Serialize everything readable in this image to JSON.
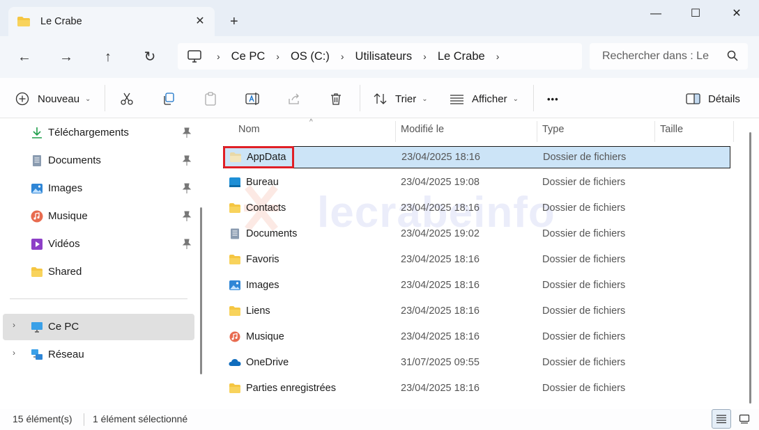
{
  "window": {
    "tab_title": "Le Crabe",
    "tab_close": "✕",
    "new_tab": "+",
    "minimize": "—",
    "maximize": "☐",
    "close": "✕"
  },
  "nav": {
    "back": "←",
    "forward": "→",
    "up": "↑",
    "refresh": "↻"
  },
  "breadcrumb": [
    "Ce PC",
    "OS (C:)",
    "Utilisateurs",
    "Le Crabe"
  ],
  "search": {
    "placeholder": "Rechercher dans : Le"
  },
  "toolbar": {
    "new_label": "Nouveau",
    "sort_label": "Trier",
    "view_label": "Afficher",
    "more_label": "•••",
    "details_label": "Détails",
    "caret": "⌄"
  },
  "sidebar": {
    "quick_access": [
      {
        "label": "Téléchargements",
        "icon": "download-icon",
        "pinned": true
      },
      {
        "label": "Documents",
        "icon": "document-icon",
        "pinned": true
      },
      {
        "label": "Images",
        "icon": "image-icon",
        "pinned": true
      },
      {
        "label": "Musique",
        "icon": "music-icon",
        "pinned": true
      },
      {
        "label": "Vidéos",
        "icon": "video-icon",
        "pinned": true
      },
      {
        "label": "Shared",
        "icon": "folder-icon",
        "pinned": false
      }
    ],
    "locations": [
      {
        "label": "Ce PC",
        "icon": "computer-icon",
        "selected": true
      },
      {
        "label": "Réseau",
        "icon": "network-icon",
        "selected": false
      }
    ],
    "expander": "›"
  },
  "columns": {
    "name": "Nom",
    "modified": "Modifié le",
    "type": "Type",
    "size": "Taille",
    "sort_indicator": "^"
  },
  "files": [
    {
      "name": "AppData",
      "date": "23/04/2025 18:16",
      "type": "Dossier de fichiers",
      "icon": "folder-icon",
      "selected": true
    },
    {
      "name": "Bureau",
      "date": "23/04/2025 19:08",
      "type": "Dossier de fichiers",
      "icon": "desktop-folder-icon",
      "selected": false
    },
    {
      "name": "Contacts",
      "date": "23/04/2025 18:16",
      "type": "Dossier de fichiers",
      "icon": "folder-icon",
      "selected": false
    },
    {
      "name": "Documents",
      "date": "23/04/2025 19:02",
      "type": "Dossier de fichiers",
      "icon": "document-icon",
      "selected": false
    },
    {
      "name": "Favoris",
      "date": "23/04/2025 18:16",
      "type": "Dossier de fichiers",
      "icon": "folder-icon",
      "selected": false
    },
    {
      "name": "Images",
      "date": "23/04/2025 18:16",
      "type": "Dossier de fichiers",
      "icon": "image-icon",
      "selected": false
    },
    {
      "name": "Liens",
      "date": "23/04/2025 18:16",
      "type": "Dossier de fichiers",
      "icon": "folder-icon",
      "selected": false
    },
    {
      "name": "Musique",
      "date": "23/04/2025 18:16",
      "type": "Dossier de fichiers",
      "icon": "music-icon",
      "selected": false
    },
    {
      "name": "OneDrive",
      "date": "31/07/2025 09:55",
      "type": "Dossier de fichiers",
      "icon": "onedrive-icon",
      "selected": false
    },
    {
      "name": "Parties enregistrées",
      "date": "23/04/2025 18:16",
      "type": "Dossier de fichiers",
      "icon": "folder-icon",
      "selected": false
    }
  ],
  "watermark": "lecrabeinfo",
  "status": {
    "count": "15 élément(s)",
    "selection": "1 élément sélectionné"
  },
  "colors": {
    "selection_bg": "#cce4f7",
    "highlight_border": "#e01f26",
    "folder_yellow": "#f5c642"
  }
}
